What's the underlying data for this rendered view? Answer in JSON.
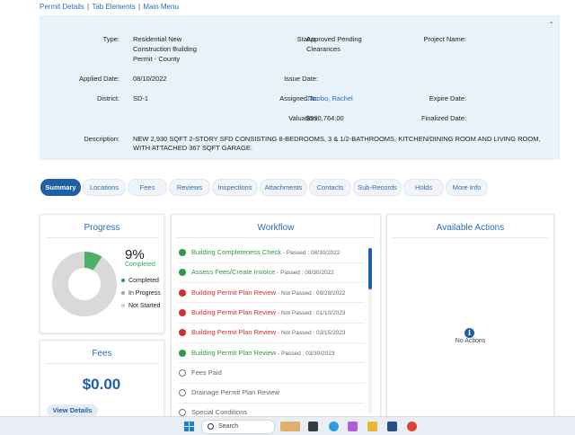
{
  "top_links": [
    "Permit Details",
    "Tab Elements",
    "Main Menu"
  ],
  "details": {
    "type_label": "Type:",
    "type_value_1": "Residential New",
    "type_value_2": "Construction Building",
    "type_value_3": "Permit - County",
    "status_label": "Status:",
    "status_value_1": "Approved Pending",
    "status_value_2": "Clearances",
    "project_name_label": "Project Name:",
    "applied_date_label": "Applied Date:",
    "applied_date_value": "08/10/2022",
    "issue_date_label": "Issue Date:",
    "district_label": "District:",
    "district_value": "SD-1",
    "assigned_to_label": "Assigned To:",
    "assigned_to_value": "Jacobo, Rachel",
    "expire_date_label": "Expire Date:",
    "valuation_label": "Valuation:",
    "valuation_value": "$590,764.00",
    "finalized_date_label": "Finalized Date:",
    "description_label": "Description:",
    "description_line_1": "NEW 2,930 SQFT 2-STORY SFD CONSISTING 8-BEDROOMS, 3 & 1/2-BATHROOMS, KITCHEN/DINING ROOM AND LIVING ROOM,",
    "description_line_2": "WITH ATTACHED 367 SQFT GARAGE."
  },
  "tabs": [
    "Summary",
    "Locations",
    "Fees",
    "Reviews",
    "Inspections",
    "Attachments",
    "Contacts",
    "Sub-Records",
    "Holds",
    "More Info"
  ],
  "progress": {
    "title": "Progress",
    "percent_text": "9%",
    "percent_label": "Completed",
    "completed_fraction": 0.09,
    "legend": [
      "Completed",
      "In Progress",
      "Not Started"
    ]
  },
  "fees": {
    "title": "Fees",
    "amount": "$0.00",
    "view_details": "View Details"
  },
  "workflow": {
    "title": "Workflow",
    "items": [
      {
        "name": "Building Completeness Check",
        "status": "Passed : 08/30/2022",
        "state": "pass"
      },
      {
        "name": "Assess Fees/Create Invoice",
        "status": "Passed : 08/30/2022",
        "state": "pass"
      },
      {
        "name": "Building Permit Plan Review",
        "status": "Not Passed : 09/29/2022",
        "state": "fail"
      },
      {
        "name": "Building Permit Plan Review",
        "status": "Not Passed : 01/10/2023",
        "state": "fail"
      },
      {
        "name": "Building Permit Plan Review",
        "status": "Not Passed : 03/15/2023",
        "state": "fail"
      },
      {
        "name": "Building Permit Plan Review",
        "status": "Passed : 03/30/2023",
        "state": "pass"
      },
      {
        "name": "Fees Paid",
        "status": "",
        "state": "todo"
      },
      {
        "name": "Drainage Permit Plan Review",
        "status": "",
        "state": "todo"
      },
      {
        "name": "Special Conditions",
        "status": "",
        "state": "todo"
      }
    ]
  },
  "actions": {
    "title": "Available Actions",
    "empty_text": "No Actions"
  },
  "taskbar": {
    "search_placeholder": "Search"
  },
  "colors": {
    "accent": "#1f5fa8",
    "link": "#2a6ebb",
    "pass": "#2d9a46",
    "fail": "#d0312d",
    "panel": "#e8f2fb"
  }
}
